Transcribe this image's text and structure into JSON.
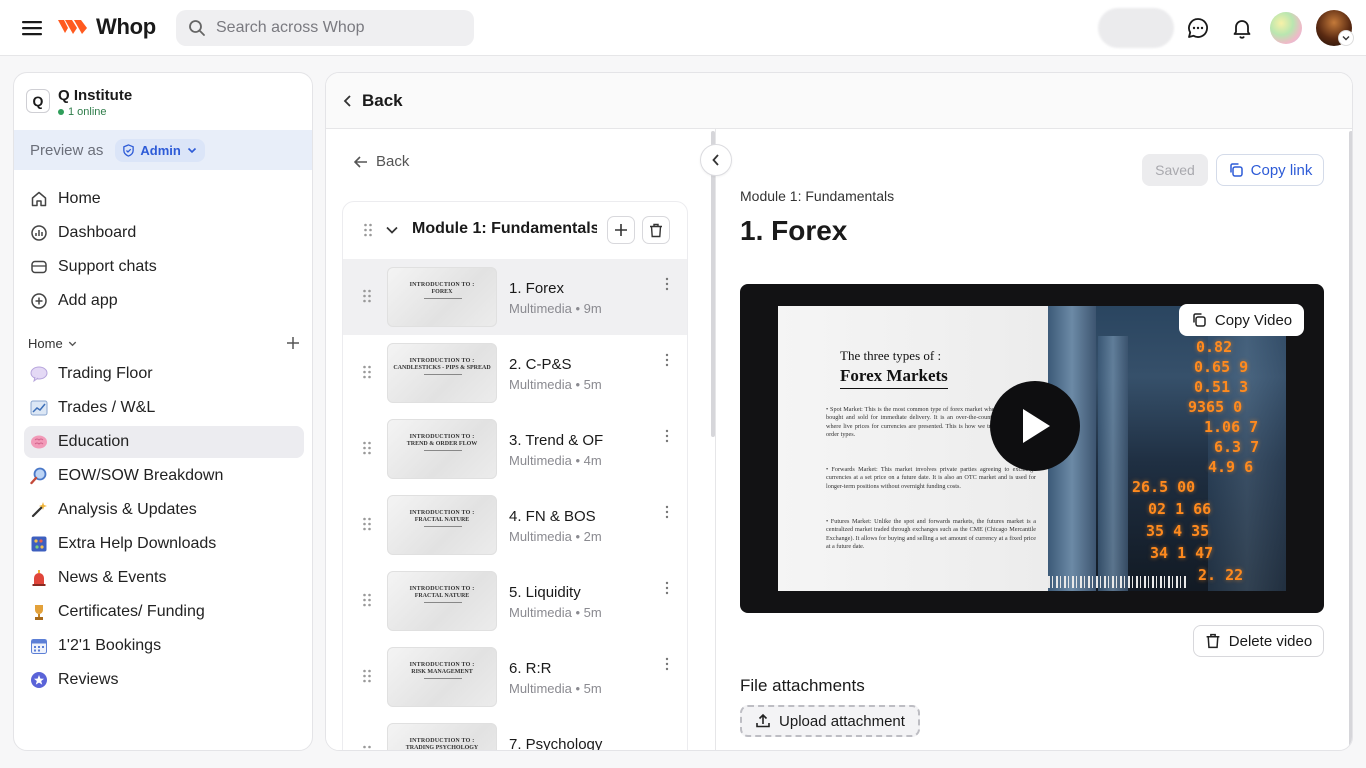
{
  "topbar": {
    "brand": "Whop",
    "search_placeholder": "Search across Whop"
  },
  "sidebar": {
    "org_initial": "Q",
    "org_name": "Q Institute",
    "online": "1 online",
    "preview_label": "Preview as",
    "preview_role": "Admin",
    "main_items": [
      {
        "label": "Home",
        "icon": "home-icon"
      },
      {
        "label": "Dashboard",
        "icon": "dashboard-icon"
      },
      {
        "label": "Support chats",
        "icon": "chat-icon"
      },
      {
        "label": "Add app",
        "icon": "plus-circle-icon"
      }
    ],
    "section_label": "Home",
    "apps": [
      {
        "label": "Trading Floor",
        "icon": "speech-bubble-icon",
        "color": "#d9cdf3"
      },
      {
        "label": "Trades / W&L",
        "icon": "chart-icon",
        "color": "#9fb8dc"
      },
      {
        "label": "Education",
        "icon": "brain-icon",
        "color": "#f29ab8",
        "active": true
      },
      {
        "label": "EOW/SOW Breakdown",
        "icon": "magnifier-icon",
        "color": "#5b8bd9"
      },
      {
        "label": "Analysis & Updates",
        "icon": "magic-wand-icon",
        "color": "#e8c07a"
      },
      {
        "label": "Extra Help Downloads",
        "icon": "abacus-icon",
        "color": "#4a6fcf"
      },
      {
        "label": "News & Events",
        "icon": "siren-icon",
        "color": "#e0453a"
      },
      {
        "label": "Certificates/ Funding",
        "icon": "trophy-icon",
        "color": "#e3a13a"
      },
      {
        "label": "1'2'1 Bookings",
        "icon": "calendar-icon",
        "color": "#5c7fd6"
      },
      {
        "label": "Reviews",
        "icon": "star-icon",
        "color": "#5a63d8"
      }
    ]
  },
  "main": {
    "back_label": "Back",
    "back_small_label": "Back",
    "module_title": "Module 1: Fundamentals",
    "lessons": [
      {
        "title": "1. Forex",
        "meta": "Multimedia • 9m",
        "thumb_line1": "INTRODUCTION TO :",
        "thumb_line2": "FOREX"
      },
      {
        "title": "2. C-P&S",
        "meta": "Multimedia • 5m",
        "thumb_line1": "INTRODUCTION TO :",
        "thumb_line2": "CANDLESTICKS - PIPS & SPREAD"
      },
      {
        "title": "3. Trend & OF",
        "meta": "Multimedia • 4m",
        "thumb_line1": "INTRODUCTION TO :",
        "thumb_line2": "TREND & ORDER FLOW"
      },
      {
        "title": "4. FN & BOS",
        "meta": "Multimedia • 2m",
        "thumb_line1": "INTRODUCTION TO :",
        "thumb_line2": "FRACTAL NATURE"
      },
      {
        "title": "5. Liquidity",
        "meta": "Multimedia • 5m",
        "thumb_line1": "INTRODUCTION TO :",
        "thumb_line2": "FRACTAL NATURE"
      },
      {
        "title": "6. R:R",
        "meta": "Multimedia • 5m",
        "thumb_line1": "INTRODUCTION TO :",
        "thumb_line2": "RISK MANAGEMENT"
      },
      {
        "title": "7. Psychology",
        "meta": "",
        "thumb_line1": "INTRODUCTION TO :",
        "thumb_line2": "TRADING PSYCHOLOGY"
      }
    ],
    "saved_label": "Saved",
    "copy_link_label": "Copy link",
    "breadcrumb": "Module 1: Fundamentals",
    "lesson_title": "1. Forex",
    "copy_video_label": "Copy Video",
    "delete_video_label": "Delete video",
    "file_attachments_label": "File attachments",
    "upload_label": "Upload attachment",
    "slide": {
      "heading1": "The three types of :",
      "heading2": "Forex Markets",
      "p1": "• Spot Market: This is the most common type of forex market where currencies are bought and sold for immediate delivery. It is an over-the-counter (OTC) market where live prices for currencies are presented. This is how we trade with different order types.",
      "p2": "• Forwards Market: This market involves private parties agreeing to exchange currencies at a set price on a future date. It is also an OTC market and is used for longer-term positions without overnight funding costs.",
      "p3": "• Futures Market: Unlike the spot and forwards markets, the futures market is a centralized market traded through exchanges such as the CME (Chicago Mercantile Exchange). It allows for buying and selling a set amount of currency at a fixed price at a future date.",
      "tickers": [
        "0.82",
        "0.65 9",
        "0.51 3",
        "9365 0",
        "1.06 7",
        "6.3 7",
        "4.9 6",
        "26.5 00",
        "02 1 66",
        "35 4 35",
        "34 1 47",
        "2. 22"
      ]
    }
  }
}
